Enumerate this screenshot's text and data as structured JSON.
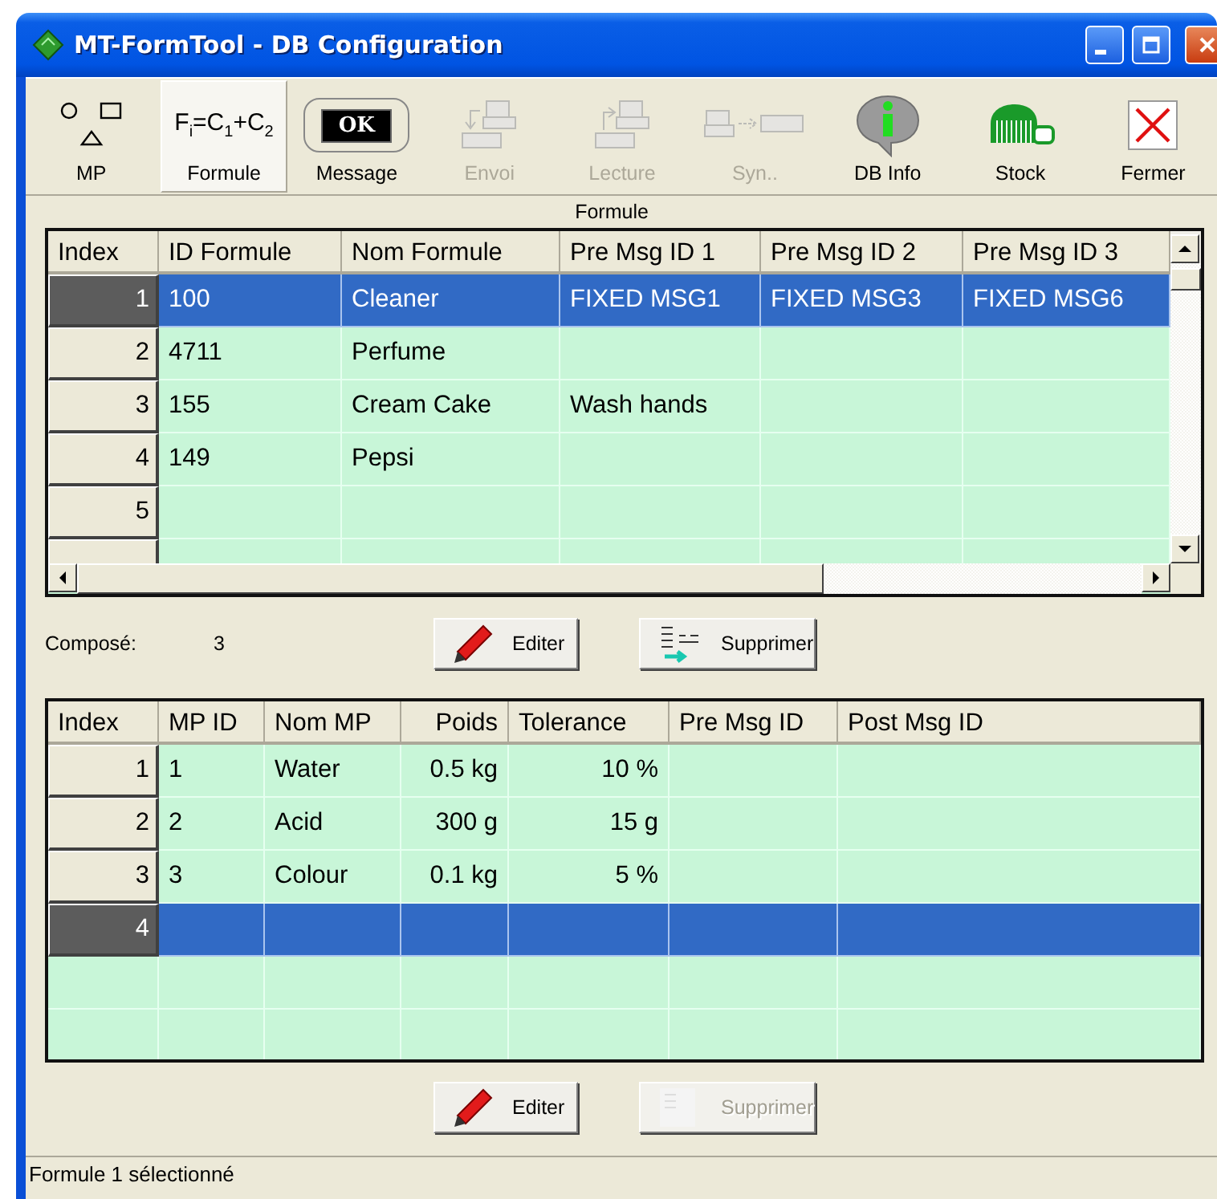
{
  "window": {
    "title": "MT-FormTool - DB Configuration"
  },
  "toolbar": [
    {
      "label": "MP",
      "kind": "icon",
      "selected": false,
      "disabled": false
    },
    {
      "label": "Formule",
      "kind": "formula",
      "symbol": "F$_{i}$=C$_{1}$+C$_{2}$",
      "selected": true,
      "disabled": false
    },
    {
      "label": "Message",
      "kind": "key",
      "symbol": "OK",
      "selected": false,
      "disabled": false
    },
    {
      "label": "Envoi",
      "kind": "icon",
      "selected": false,
      "disabled": true
    },
    {
      "label": "Lecture",
      "kind": "icon",
      "selected": false,
      "disabled": true
    },
    {
      "label": "Syn..",
      "kind": "icon",
      "selected": false,
      "disabled": true
    },
    {
      "label": "DB Info",
      "kind": "icon",
      "selected": false,
      "disabled": false
    },
    {
      "label": "Stock",
      "kind": "icon",
      "selected": false,
      "disabled": false
    },
    {
      "label": "Fermer",
      "kind": "icon",
      "selected": false,
      "disabled": false
    }
  ],
  "formula_panel": {
    "title": "Formule",
    "table": {
      "columns": [
        "Index",
        "ID Formule",
        "Nom Formule",
        "Pre Msg ID 1",
        "Pre Msg ID 2",
        "Pre Msg ID 3"
      ],
      "rows": [
        {
          "index": "1",
          "cells": [
            "100",
            "Cleaner",
            "FIXED MSG1",
            "FIXED MSG3",
            "FIXED MSG6"
          ],
          "selected": true
        },
        {
          "index": "2",
          "cells": [
            "4711",
            "Perfume"
          ],
          "selected": false
        },
        {
          "index": "3",
          "cells": [
            "155",
            "Cream Cake",
            "Wash hands"
          ],
          "selected": false
        },
        {
          "index": "4",
          "cells": [
            "149",
            "Pepsi"
          ],
          "selected": false
        },
        {
          "index": "5",
          "selected": false
        }
      ]
    }
  },
  "composed": {
    "label": "Composé:",
    "value": "3"
  },
  "formula_actions": [
    {
      "label": "Editer",
      "disabled": false
    },
    {
      "label": "Supprimer",
      "disabled": false
    }
  ],
  "mp_table": {
    "columns": [
      "Index",
      "MP ID",
      "Nom MP",
      "Poids",
      "Tolerance",
      "Pre Msg ID",
      "Post Msg ID"
    ],
    "rows": [
      {
        "index": "1",
        "cells": [
          "1",
          "Water",
          "0.5 kg",
          "10 %"
        ],
        "selected": false
      },
      {
        "index": "2",
        "cells": [
          "2",
          "Acid",
          "300 g",
          "15 g"
        ],
        "selected": false
      },
      {
        "index": "3",
        "cells": [
          "3",
          "Colour",
          "0.1 kg",
          "5 %"
        ],
        "selected": false
      },
      {
        "index": "4",
        "selected": true
      }
    ]
  },
  "mp_actions": [
    {
      "label": "Editer",
      "disabled": false
    },
    {
      "label": "Supprimer",
      "disabled": true
    }
  ],
  "status_bar": {
    "text": "Formule 1 sélectionné"
  }
}
